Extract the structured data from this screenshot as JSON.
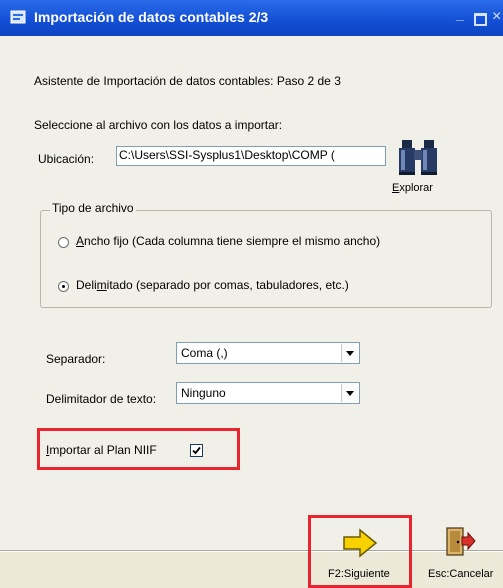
{
  "window": {
    "title": "Importación de datos contables 2/3",
    "minimize": "_",
    "close": "×"
  },
  "wizard": {
    "step_text": "Asistente de Importación de datos contables: Paso 2 de 3",
    "instruction": "Seleccione al archivo con los datos a importar:"
  },
  "location": {
    "label": "Ubicación:",
    "value": "C:\\Users\\SSI-Sysplus1\\Desktop\\COMP (",
    "browse_label_underlined": "E",
    "browse_label_rest": "xplorar",
    "icon": "binoculars-icon"
  },
  "file_type": {
    "group_title": "Tipo de archivo",
    "options": [
      {
        "mnemonic": "A",
        "rest": "ncho fijo (Cada columna tiene siempre el mismo ancho)",
        "checked": false
      },
      {
        "prefix": "Deli",
        "mnemonic": "m",
        "rest": "itado (separado por comas, tabuladores, etc.)",
        "checked": true
      }
    ]
  },
  "separator": {
    "label": "Separador:",
    "value": "Coma (,)"
  },
  "text_delimiter": {
    "label": "Delimitador de texto:",
    "value": "Ninguno"
  },
  "niif": {
    "label_mnemonic": "I",
    "label_rest": "mportar al Plan  NIIF",
    "checked": true
  },
  "buttons": {
    "next": {
      "label": "F2:Siguiente",
      "icon": "arrow-right-icon"
    },
    "cancel": {
      "label": "Esc:Cancelar",
      "icon": "exit-door-icon"
    }
  },
  "colors": {
    "title_bar": "#1450d6",
    "highlight": "#e8252e",
    "next_arrow": "#f7d200"
  }
}
